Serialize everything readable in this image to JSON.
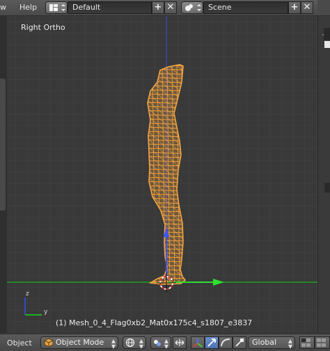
{
  "menu": {
    "view_partial": "w",
    "help": "Help"
  },
  "screen_layout": {
    "value": "Default"
  },
  "scene_selector": {
    "value": "Scene"
  },
  "viewport": {
    "view_name": "Right Ortho",
    "object_info": "(1) Mesh_0_4_Flag0xb2_Mat0x175c4_s1807_e3837",
    "mesh_color": "#f5a542",
    "grid_color": "#454545",
    "y_axis_color": "#1db31d",
    "z_axis_color": "#3549c8",
    "gizmo_axes": {
      "z": "z",
      "y": "y"
    }
  },
  "bottom_header": {
    "menu_object": "Object",
    "mode": "Object Mode",
    "orientation": "Global"
  },
  "colors": {
    "accent": "#5680c2",
    "header_bg": "#4f4f4f",
    "viewport_bg": "#393939"
  }
}
